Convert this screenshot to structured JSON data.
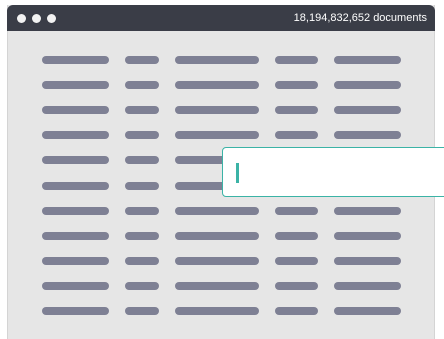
{
  "window": {
    "controls": [
      "window-dot",
      "window-dot",
      "window-dot"
    ],
    "document_count_text": "18,194,832,652 documents"
  },
  "table": {
    "rows": 11,
    "columns": 5
  },
  "search": {
    "value": "",
    "caret_color": "#3bb3a6",
    "border_color": "#3bb3a6"
  },
  "colors": {
    "titlebar": "#3a3d47",
    "window_background": "#e6e6e6",
    "placeholder_bar": "#7e8094"
  }
}
